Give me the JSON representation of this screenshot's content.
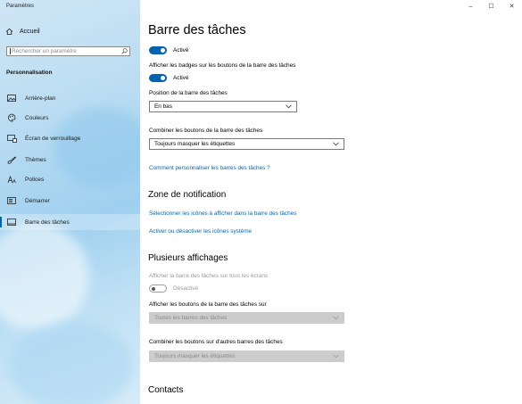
{
  "window": {
    "title": "Paramètres",
    "controls": {
      "minimize": "–",
      "maximize": "☐",
      "close": "✕"
    }
  },
  "sidebar": {
    "home_label": "Accueil",
    "search_placeholder": "Rechercher un paramètre",
    "section": "Personnalisation",
    "items": [
      {
        "label": "Arrière-plan",
        "icon": "picture-icon"
      },
      {
        "label": "Couleurs",
        "icon": "palette-icon"
      },
      {
        "label": "Écran de verrouillage",
        "icon": "lock-screen-icon"
      },
      {
        "label": "Thèmes",
        "icon": "brush-icon"
      },
      {
        "label": "Polices",
        "icon": "font-icon"
      },
      {
        "label": "Démarrer",
        "icon": "start-icon"
      },
      {
        "label": "Barre des tâches",
        "icon": "taskbar-icon",
        "selected": true
      }
    ]
  },
  "main": {
    "title": "Barre des tâches",
    "toggle1": {
      "state": "Activé",
      "on": true
    },
    "badges": {
      "label": "Afficher les badges sur les boutons de la barre des tâches",
      "state": "Activé",
      "on": true
    },
    "position": {
      "label": "Position de la barre des tâches",
      "value": "En bas"
    },
    "combine": {
      "label": "Combiner les boutons de la barre des tâches",
      "value": "Toujours masquer les étiquettes"
    },
    "customize_link": "Comment personnaliser les barres des tâches ?",
    "notification": {
      "heading": "Zone de notification",
      "link1": "Sélectionner les icônes à afficher dans la barre des tâches",
      "link2": "Activer ou désactiver les icônes système"
    },
    "multi": {
      "heading": "Plusieurs affichages",
      "show_all_label": "Afficher la barre des tâches sur tous les écrans",
      "show_all_state": "Désactivé",
      "buttons_on_label": "Afficher les boutons de la barre des tâches sur",
      "buttons_on_value": "Toutes les barres des tâches",
      "combine_other_label": "Combiner les boutons sur d'autres barres des tâches",
      "combine_other_value": "Toujours masquer les étiquettes"
    },
    "contacts_heading": "Contacts"
  },
  "colors": {
    "accent": "#0063b1",
    "link": "#0067b8",
    "disabled_text": "#9a9a9a"
  }
}
